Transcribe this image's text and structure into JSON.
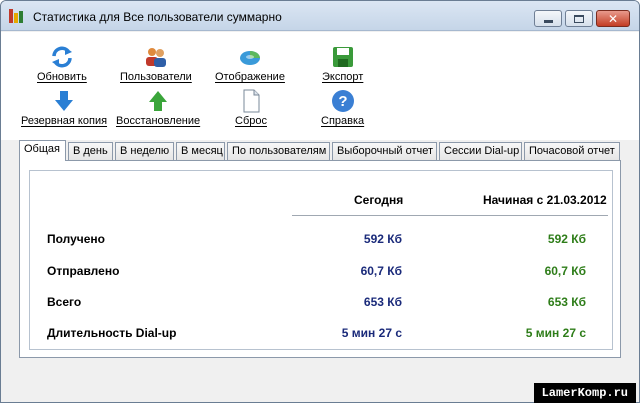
{
  "window": {
    "title": "Статистика для Все пользователи суммарно",
    "controls": {
      "minimize_icon": "minimize-icon",
      "maximize_icon": "maximize-icon",
      "close_icon": "close-icon"
    }
  },
  "toolbar": {
    "items": [
      {
        "label": "Обновить",
        "icon": "refresh-icon"
      },
      {
        "label": "Пользователи",
        "icon": "users-icon"
      },
      {
        "label": "Отображение",
        "icon": "display-icon"
      },
      {
        "label": "Экспорт",
        "icon": "export-icon"
      },
      {
        "label": "Резервная копия",
        "icon": "backup-icon"
      },
      {
        "label": "Восстановление",
        "icon": "restore-icon"
      },
      {
        "label": "Сброс",
        "icon": "reset-icon"
      },
      {
        "label": "Справка",
        "icon": "help-icon"
      }
    ]
  },
  "tabs": [
    {
      "label": "Общая",
      "active": true
    },
    {
      "label": "В день"
    },
    {
      "label": "В неделю"
    },
    {
      "label": "В месяц"
    },
    {
      "label": "По пользователям"
    },
    {
      "label": "Выборочный отчет"
    },
    {
      "label": "Сессии Dial-up"
    },
    {
      "label": "Почасовой отчет"
    }
  ],
  "summary": {
    "columns": {
      "today": "Сегодня",
      "since": "Начиная с 21.03.2012"
    },
    "rows": [
      {
        "label": "Получено",
        "today": "592 Кб",
        "since": "592 Кб"
      },
      {
        "label": "Отправлено",
        "today": "60,7 Кб",
        "since": "60,7 Кб"
      },
      {
        "label": "Всего",
        "today": "653 Кб",
        "since": "653 Кб"
      },
      {
        "label": "Длительность Dial-up",
        "today": "5 мин 27 с",
        "since": "5 мин 27 с"
      }
    ],
    "colors": {
      "today": "#1a2a7a",
      "since": "#2e7d19"
    }
  },
  "watermark": "LamerKomp.ru"
}
